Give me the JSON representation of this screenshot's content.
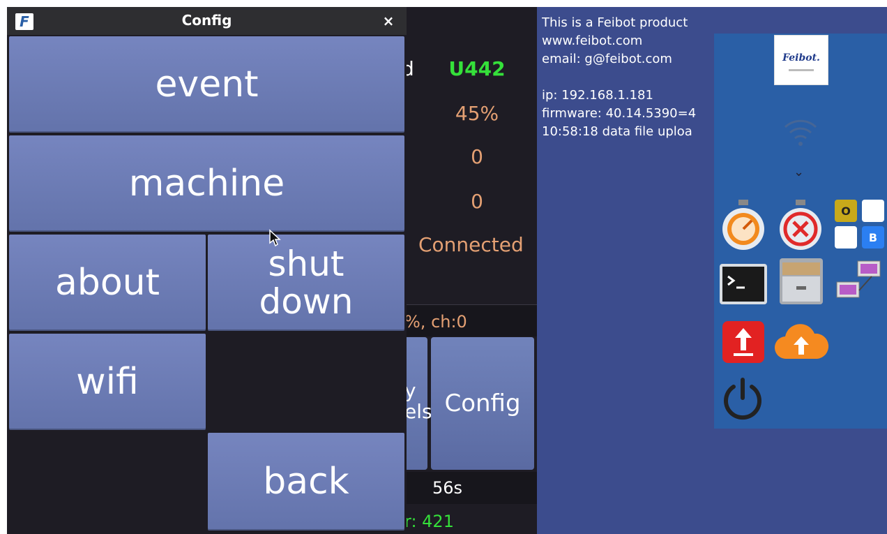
{
  "background_app": {
    "partial_label": "d",
    "stats": [
      "U442",
      "45%",
      "0",
      "0",
      "Connected"
    ],
    "status_text": "%, ch:0",
    "cut_button_line1": "y",
    "cut_button_line2": "els",
    "config_button": "Config",
    "timer": "56s",
    "counter": "r: 421"
  },
  "desktop": {
    "info_lines": [
      "This is a Feibot product",
      "www.feibot.com",
      "email: g@feibot.com",
      "",
      "ip: 192.168.1.181",
      "firmware: 40.14.5390=4",
      "10:58:18 data file uploa"
    ],
    "logo_text": "Feibot.",
    "tiles": [
      {
        "label": "O",
        "color": "#c8a91a"
      },
      {
        "label": "",
        "color": "#ffffff"
      },
      {
        "label": "",
        "color": "#ffffff"
      },
      {
        "label": "B",
        "color": "#2b7ff2"
      }
    ],
    "icons": [
      "stopwatch-icon",
      "stop-timer-icon",
      "terminal-icon",
      "file-cabinet-icon",
      "network-icon",
      "upload-icon",
      "cloud-upload-icon",
      "power-icon"
    ]
  },
  "config_window": {
    "title": "Config",
    "close": "×",
    "buttons": {
      "event": "event",
      "machine": "machine",
      "about": "about",
      "shutdown_line1": "shut",
      "shutdown_line2": "down",
      "wifi": "wifi",
      "back": "back"
    }
  },
  "colors": {
    "accent_green": "#35e03a",
    "stat_orange": "#e4a073",
    "button_blue": "#6c7cb5",
    "dock_blue": "#2a5fa6"
  }
}
